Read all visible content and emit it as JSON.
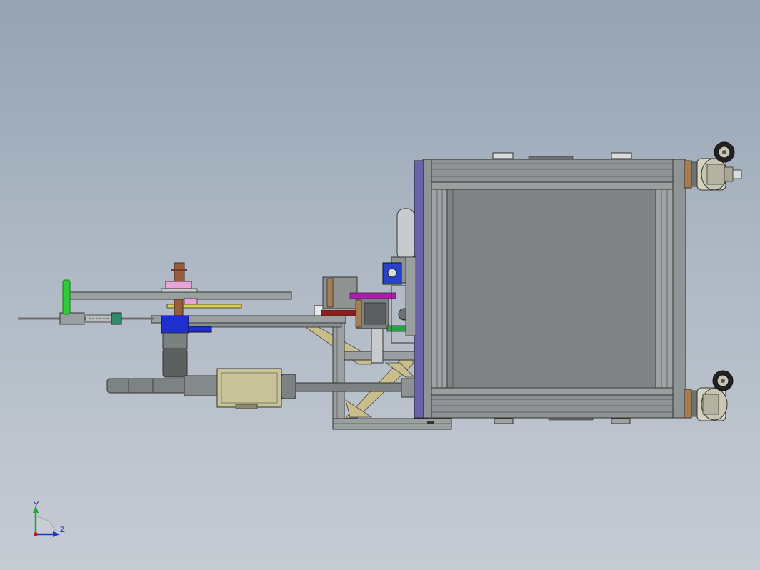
{
  "viewport": {
    "colors": {
      "frame": "#8e9394",
      "frame_dark": "#5e6364",
      "panel": "#7f8384",
      "plate_purple": "#6a63a8",
      "bronze": "#a57d52",
      "motor": "#c9c39a",
      "blue_block": "#1e2fd0",
      "green": "#2ecc3a",
      "magenta": "#b01cb0",
      "brace": "#c9bd8c"
    }
  },
  "triad": {
    "y_label": "Y",
    "z_label": "Z",
    "icon": "coordinate-triad-icon"
  }
}
